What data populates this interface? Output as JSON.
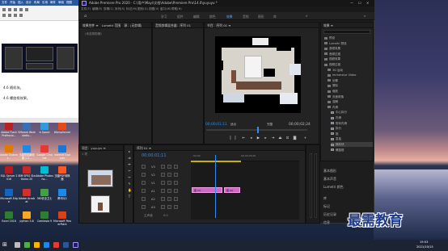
{
  "premiere": {
    "title": "Adobe Premiere Pro 2020 - C:\\用户\\Mayi\\文档\\Adobe\\Premiere Pro\\14.0\\yuyuyu *",
    "menus": [
      "文件(F)",
      "编辑(E)",
      "剪辑(C)",
      "序列(S)",
      "标记(M)",
      "图形(G)",
      "视图(V)",
      "窗口(W)",
      "帮助(H)"
    ],
    "workspaces": [
      "学习",
      "组件",
      "编辑",
      "颜色",
      "效果",
      "音频",
      "图形",
      "库"
    ],
    "active_workspace": "效果",
    "source_panel": {
      "tabs": [
        "效果控件 ≡",
        "Lumetri 范围",
        "源：(无剪辑)"
      ],
      "empty_text": "(未选择剪辑)"
    },
    "audio_panel": {
      "tab": "音频剪辑混合器：序列 01"
    },
    "program_panel": {
      "tab": "节目：序列 01 ≡",
      "timecode": "00;00;01;11",
      "fit": "适合",
      "quality": "完整",
      "duration": "00;00;02;24"
    },
    "effects_panel": {
      "tab": "效果 ≡",
      "items": [
        {
          "label": "预设",
          "type": "folder"
        },
        {
          "label": "Lumetri 预设",
          "type": "folder"
        },
        {
          "label": "音频效果",
          "type": "folder"
        },
        {
          "label": "音频过渡",
          "type": "folder"
        },
        {
          "label": "视频效果",
          "type": "folder"
        },
        {
          "label": "视频过渡",
          "type": "folder"
        },
        {
          "label": "3D 运动",
          "type": "folder"
        },
        {
          "label": "Immersive Video",
          "type": "folder"
        },
        {
          "label": "划像",
          "type": "folder"
        },
        {
          "label": "擦除",
          "type": "folder"
        },
        {
          "label": "缩放",
          "type": "folder"
        },
        {
          "label": "页面剥落",
          "type": "folder"
        },
        {
          "label": "溶解",
          "type": "folder"
        },
        {
          "label": "内滑",
          "type": "folder"
        },
        {
          "label": "中心拆分",
          "type": "item"
        },
        {
          "label": "内滑",
          "type": "item"
        },
        {
          "label": "带状内滑",
          "type": "item"
        },
        {
          "label": "拆分",
          "type": "item"
        },
        {
          "label": "推",
          "type": "item"
        },
        {
          "label": "急摇",
          "type": "item"
        },
        {
          "label": "随机块",
          "type": "item"
        },
        {
          "label": "螺旋框",
          "type": "item"
        }
      ],
      "lower_sections": [
        "基本图形",
        "基本声音",
        "Lumetri 颜色",
        "库",
        "标记",
        "历史记录",
        "信息"
      ]
    },
    "project_panel": {
      "tab": "项目：yuyuyu ≡",
      "items_label": "1 项"
    },
    "timeline": {
      "tab": "序列 01 ≡",
      "timecode": "00;00;01;11",
      "ruler_start": ":00:00",
      "ruler_end": "00;00;05;00",
      "tracks": [
        "V3",
        "V2",
        "V1",
        "A1",
        "A2",
        "A3"
      ],
      "master": "主声道",
      "master_value": "0.0",
      "clip1_label": "图 [V]",
      "clip2_label": "图 [A]"
    }
  },
  "word_doc": {
    "tabs": [
      "文件",
      "开始",
      "插入",
      "设计",
      "布局",
      "引用",
      "邮件",
      "审阅",
      "视图"
    ],
    "lines": [
      "4.6 随机块。",
      "4.6 螺旋框效果。"
    ]
  },
  "desktop_icons": [
    {
      "label": "Adobe Flash Professio...",
      "color": "#b82222"
    },
    {
      "label": "VMware Workstatio...",
      "color": "#3a6fb6"
    },
    {
      "label": "e-Space",
      "color": "#3399dd"
    },
    {
      "label": "WampServer",
      "color": "#e64a19"
    },
    {
      "label": "Adobe Illustrat...",
      "color": "#e07b00"
    },
    {
      "label": "迅捷视频编辑器 1.2...",
      "color": "#1e88e5"
    },
    {
      "label": "Google Chrome",
      "color": "#e53935"
    },
    {
      "label": "Internet Explorer",
      "color": "#1976d2"
    },
    {
      "label": "SQL Server 2016",
      "color": "#b71c1c"
    },
    {
      "label": "IBM SPSS Statistics 20",
      "color": "#c62828"
    },
    {
      "label": "Adobe Photosho...",
      "color": "#00bcd4"
    },
    {
      "label": "迅捷PDF转换器",
      "color": "#ff5722"
    },
    {
      "label": "Microsoft Edge",
      "color": "#1565c0"
    },
    {
      "label": "Adobe Acrobat",
      "color": "#d32f2f"
    },
    {
      "label": "360安全卫士",
      "color": "#43a047"
    },
    {
      "label": "腾讯QQ",
      "color": "#1e88e5"
    },
    {
      "label": "Excel 2016",
      "color": "#2e7d32"
    },
    {
      "label": "python 3.8",
      "color": "#f9a825"
    },
    {
      "label": "Camtasia 9",
      "color": "#2e7d32"
    },
    {
      "label": "Microsoft PowerPoint",
      "color": "#d84315"
    },
    {
      "label": "HBuilder",
      "color": "#43a047"
    },
    {
      "label": "搜狗高速浏览器",
      "color": "#ff8f00"
    }
  ],
  "taskbar": {
    "time": "19:53",
    "date": "2021/10/15"
  },
  "watermark": "最需教育"
}
